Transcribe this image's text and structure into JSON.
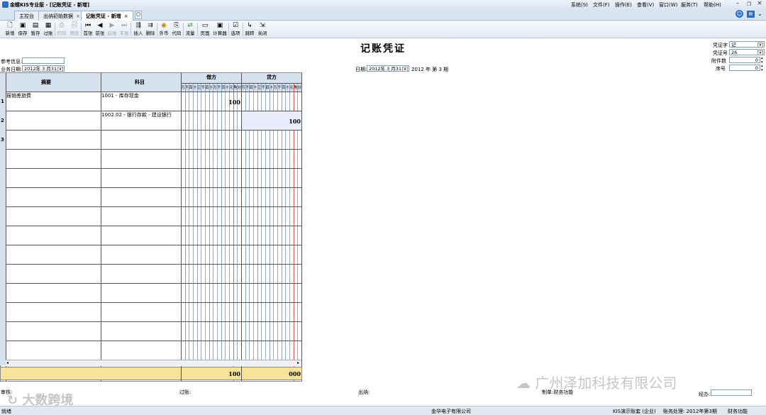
{
  "window": {
    "title": "金蝶KIS专业版 - [记账凭证 - 新增]",
    "menu": [
      "系统(S)",
      "文件(F)",
      "操作(E)",
      "查看(V)",
      "窗口(W)",
      "服务(T)",
      "帮助(H)"
    ]
  },
  "tabs": [
    {
      "label": "主控台",
      "closable": false,
      "active": false
    },
    {
      "label": "出纳初始数据",
      "closable": true,
      "active": false
    },
    {
      "label": "记账凭证 - 新增",
      "closable": true,
      "active": true
    }
  ],
  "toolbar": {
    "items": [
      {
        "label": "新增",
        "icon": "new-doc-icon",
        "enabled": true
      },
      {
        "label": "保存",
        "icon": "save-icon",
        "enabled": true
      },
      {
        "label": "暂存",
        "icon": "temp-save-icon",
        "enabled": true
      },
      {
        "label": "过账",
        "icon": "post-icon",
        "enabled": true
      },
      {
        "label": "打印",
        "icon": "print-icon",
        "enabled": false
      },
      {
        "label": "预览",
        "icon": "preview-icon",
        "enabled": false
      },
      {
        "label": "首张",
        "icon": "first-icon",
        "enabled": true
      },
      {
        "label": "前张",
        "icon": "prev-icon",
        "enabled": true
      },
      {
        "label": "后张",
        "icon": "next-icon",
        "enabled": false
      },
      {
        "label": "末张",
        "icon": "last-icon",
        "enabled": false
      },
      {
        "label": "插入",
        "icon": "insert-icon",
        "enabled": true
      },
      {
        "label": "删除",
        "icon": "delete-icon",
        "enabled": true
      },
      {
        "label": "外币",
        "icon": "currency-icon",
        "enabled": true
      },
      {
        "label": "代码",
        "icon": "code-icon",
        "enabled": true
      },
      {
        "label": "流量",
        "icon": "flow-icon",
        "enabled": true
      },
      {
        "label": "页面",
        "icon": "page-icon",
        "enabled": true
      },
      {
        "label": "计算器",
        "icon": "calculator-icon",
        "enabled": true
      },
      {
        "label": "选项",
        "icon": "options-icon",
        "enabled": true
      },
      {
        "label": "跳转",
        "icon": "jump-icon",
        "enabled": true
      },
      {
        "label": "关闭",
        "icon": "close-door-icon",
        "enabled": true
      }
    ]
  },
  "form": {
    "title": "记账凭证",
    "ref_label": "参考信息:",
    "ref_value": "",
    "bizdate_label": "业务日期",
    "bizdate_value": "2012年 3 月31日",
    "date_label": "日期:",
    "date_value": "2012年 3 月31日",
    "period_text": "2012 年 第 3 期",
    "voucher_word_label": "凭证字",
    "voucher_word_value": "记",
    "voucher_no_label": "凭证号",
    "voucher_no_value": "26",
    "attachments_label": "附件数",
    "attachments_value": "0",
    "seq_label": "序号",
    "seq_value": "0"
  },
  "grid": {
    "headers": {
      "summary": "摘要",
      "account": "科目",
      "debit": "借方",
      "credit": "贷方"
    },
    "digit_units": [
      "万",
      "千",
      "百",
      "十",
      "亿",
      "千",
      "百",
      "十",
      "万",
      "千",
      "百",
      "十",
      "元",
      "角",
      "分"
    ],
    "rows": [
      {
        "num": "1",
        "summary": "报销差旅费",
        "account": "1001 - 库存现金",
        "debit": "100",
        "credit": ""
      },
      {
        "num": "2",
        "summary": "",
        "account": "1002.02 - 银行存款 - 建设银行",
        "debit": "",
        "credit": "100"
      },
      {
        "num": "3",
        "summary": "",
        "account": "",
        "debit": "",
        "credit": ""
      }
    ],
    "totals": {
      "debit": "100",
      "credit": "000"
    }
  },
  "footer": {
    "audit_label": "审核:",
    "post_label": "过账:",
    "cashier_label": "出纳:",
    "maker_label": "制单:财务功能",
    "handler_label": "经办:"
  },
  "watermarks": {
    "left": "大数跨境",
    "right": "广州泽加科技有限公司"
  },
  "statusbar": {
    "left": "就绪",
    "company": "金华电子有限公司",
    "account_set": "KIS演示账套 (企业)",
    "period": "账务处理: 2012年第3期",
    "user": "财务功能"
  },
  "colors": {
    "accent": "#2d6cc4",
    "total_row": "#f7e29a",
    "header": "#d5e1ef",
    "red_line": "#e05a5a"
  }
}
